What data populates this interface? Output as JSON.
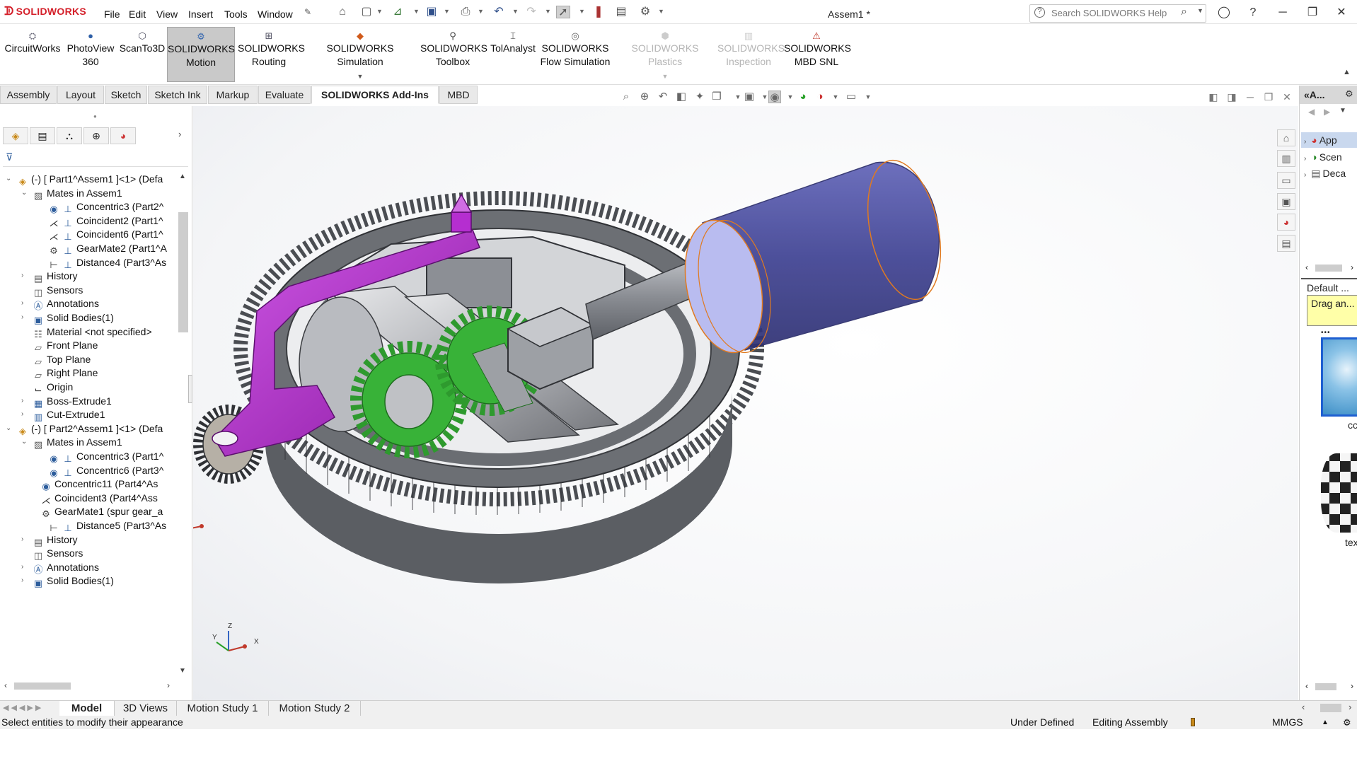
{
  "app": {
    "brand": "SOLIDWORKS",
    "doc_title": "Assem1 *"
  },
  "menu": [
    "File",
    "Edit",
    "View",
    "Insert",
    "Tools",
    "Window"
  ],
  "help_search": {
    "placeholder": "Search SOLIDWORKS Help"
  },
  "command_manager": [
    {
      "line1": "CircuitWorks",
      "line2": "",
      "state": "normal"
    },
    {
      "line1": "PhotoView",
      "line2": "360",
      "state": "normal"
    },
    {
      "line1": "ScanTo3D",
      "line2": "",
      "state": "normal"
    },
    {
      "line1": "SOLIDWORKS",
      "line2": "Motion",
      "state": "active"
    },
    {
      "line1": "SOLIDWORKS",
      "line2": "Routing",
      "state": "normal"
    },
    {
      "line1": "SOLIDWORKS Simulation",
      "line2": "",
      "state": "normal"
    },
    {
      "line1": "SOLIDWORKS",
      "line2": "Toolbox",
      "state": "normal"
    },
    {
      "line1": "TolAnalyst",
      "line2": "",
      "state": "normal"
    },
    {
      "line1": "SOLIDWORKS",
      "line2": "Flow Simulation",
      "state": "normal"
    },
    {
      "line1": "SOLIDWORKS Plastics",
      "line2": "",
      "state": "disabled"
    },
    {
      "line1": "SOLIDWORKS",
      "line2": "Inspection",
      "state": "disabled"
    },
    {
      "line1": "SOLIDWORKS",
      "line2": "MBD SNL",
      "state": "normal"
    }
  ],
  "tabs": [
    "Assembly",
    "Layout",
    "Sketch",
    "Sketch Ink",
    "Markup",
    "Evaluate",
    "SOLIDWORKS Add-Ins",
    "MBD"
  ],
  "selected_tab": "SOLIDWORKS Add-Ins",
  "feature_tree": [
    {
      "label": "(-) [ Part1^Assem1 ]<1> (Defa",
      "level": 0,
      "twisty": "open",
      "icon": "part-icon"
    },
    {
      "label": "Mates in Assem1",
      "level": 1,
      "twisty": "open",
      "icon": "mates-folder-icon"
    },
    {
      "label": "Concentric3 (Part2^",
      "level": 2,
      "twisty": "",
      "icon": "concentric-mate-icon"
    },
    {
      "label": "Coincident2 (Part1^",
      "level": 2,
      "twisty": "",
      "icon": "coincident-mate-icon"
    },
    {
      "label": "Coincident6 (Part1^",
      "level": 2,
      "twisty": "",
      "icon": "coincident-mate-icon"
    },
    {
      "label": "GearMate2 (Part1^A",
      "level": 2,
      "twisty": "",
      "icon": "gear-mate-icon"
    },
    {
      "label": "Distance4 (Part3^As",
      "level": 2,
      "twisty": "",
      "icon": "distance-mate-icon"
    },
    {
      "label": "History",
      "level": 1,
      "twisty": "closed",
      "icon": "history-icon"
    },
    {
      "label": "Sensors",
      "level": 1,
      "twisty": "",
      "icon": "sensors-icon"
    },
    {
      "label": "Annotations",
      "level": 1,
      "twisty": "closed",
      "icon": "annotations-icon"
    },
    {
      "label": "Solid Bodies(1)",
      "level": 1,
      "twisty": "closed",
      "icon": "solid-bodies-icon"
    },
    {
      "label": "Material <not specified>",
      "level": 1,
      "twisty": "",
      "icon": "material-icon"
    },
    {
      "label": "Front Plane",
      "level": 1,
      "twisty": "",
      "icon": "plane-icon"
    },
    {
      "label": "Top Plane",
      "level": 1,
      "twisty": "",
      "icon": "plane-icon"
    },
    {
      "label": "Right Plane",
      "level": 1,
      "twisty": "",
      "icon": "plane-icon"
    },
    {
      "label": "Origin",
      "level": 1,
      "twisty": "",
      "icon": "origin-icon"
    },
    {
      "label": "Boss-Extrude1",
      "level": 1,
      "twisty": "closed",
      "icon": "extrude-icon"
    },
    {
      "label": "Cut-Extrude1",
      "level": 1,
      "twisty": "closed",
      "icon": "cut-extrude-icon"
    },
    {
      "label": "(-) [ Part2^Assem1 ]<1> (Defa",
      "level": 0,
      "twisty": "open",
      "icon": "part-icon"
    },
    {
      "label": "Mates in Assem1",
      "level": 1,
      "twisty": "open",
      "icon": "mates-folder-icon"
    },
    {
      "label": "Concentric3 (Part1^",
      "level": 2,
      "twisty": "",
      "icon": "concentric-mate-icon"
    },
    {
      "label": "Concentric6 (Part3^",
      "level": 2,
      "twisty": "",
      "icon": "concentric-mate-icon"
    },
    {
      "label": "Concentric11 (Part4^As",
      "level": 1.5,
      "twisty": "",
      "icon": "concentric-mate-icon"
    },
    {
      "label": "Coincident3 (Part4^Ass",
      "level": 1.5,
      "twisty": "",
      "icon": "coincident-mate-icon"
    },
    {
      "label": "GearMate1 (spur gear_a",
      "level": 1.5,
      "twisty": "",
      "icon": "gear-mate-icon"
    },
    {
      "label": "Distance5 (Part3^As",
      "level": 2,
      "twisty": "",
      "icon": "distance-mate-icon"
    },
    {
      "label": "History",
      "level": 1,
      "twisty": "closed",
      "icon": "history-icon"
    },
    {
      "label": "Sensors",
      "level": 1,
      "twisty": "",
      "icon": "sensors-icon"
    },
    {
      "label": "Annotations",
      "level": 1,
      "twisty": "closed",
      "icon": "annotations-icon"
    },
    {
      "label": "Solid Bodies(1)",
      "level": 1,
      "twisty": "closed",
      "icon": "solid-bodies-icon"
    }
  ],
  "task_pane": {
    "header": "A...",
    "items": [
      "App",
      "Scen",
      "Deca"
    ],
    "default_label": "Default ...",
    "tooltip": "Drag an...",
    "thumb1_label": "cc",
    "thumb2_label": "tex"
  },
  "bottom_tabs": [
    "Model",
    "3D Views",
    "Motion Study 1",
    "Motion Study 2"
  ],
  "selected_bottom_tab": "Model",
  "status": {
    "message": "Select entities to modify their appearance",
    "state": "Under Defined",
    "mode": "Editing Assembly",
    "units": "MMGS"
  },
  "triad": {
    "x": "X",
    "y": "Y",
    "z": "Z"
  },
  "colors": {
    "brand_red": "#d4202a",
    "gear_dark": "#5b5e63",
    "link_magenta": "#b52ed0",
    "gear_green": "#2aa12a",
    "motor_blue": "#4b4ea0",
    "selection_blue": "#c9d8ee"
  }
}
